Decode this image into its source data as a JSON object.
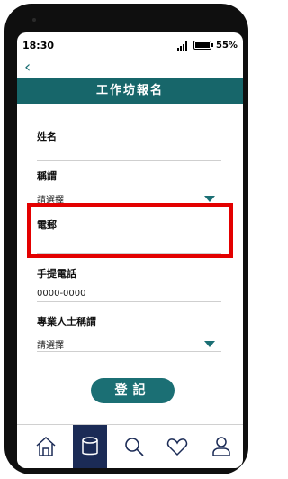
{
  "status_bar": {
    "time": "18:30",
    "battery": "55%"
  },
  "nav": {
    "back_icon": "‹"
  },
  "header": {
    "title": "工作坊報名"
  },
  "form": {
    "name": {
      "label": "姓名",
      "value": ""
    },
    "title": {
      "label": "稱謂",
      "value": "請選擇"
    },
    "email": {
      "label": "電郵",
      "value": ""
    },
    "mobile": {
      "label": "手提電話",
      "value": "0000-0000"
    },
    "professional_title": {
      "label": "專業人士稱謂",
      "value": "請選擇"
    }
  },
  "submit_label": "登記",
  "tab_bar": [
    "home-icon",
    "database-icon",
    "search-icon",
    "heart-icon",
    "user-icon"
  ],
  "colors": {
    "accent": "#17666a",
    "highlight": "#e30000",
    "active_tab": "#1b2b56"
  }
}
